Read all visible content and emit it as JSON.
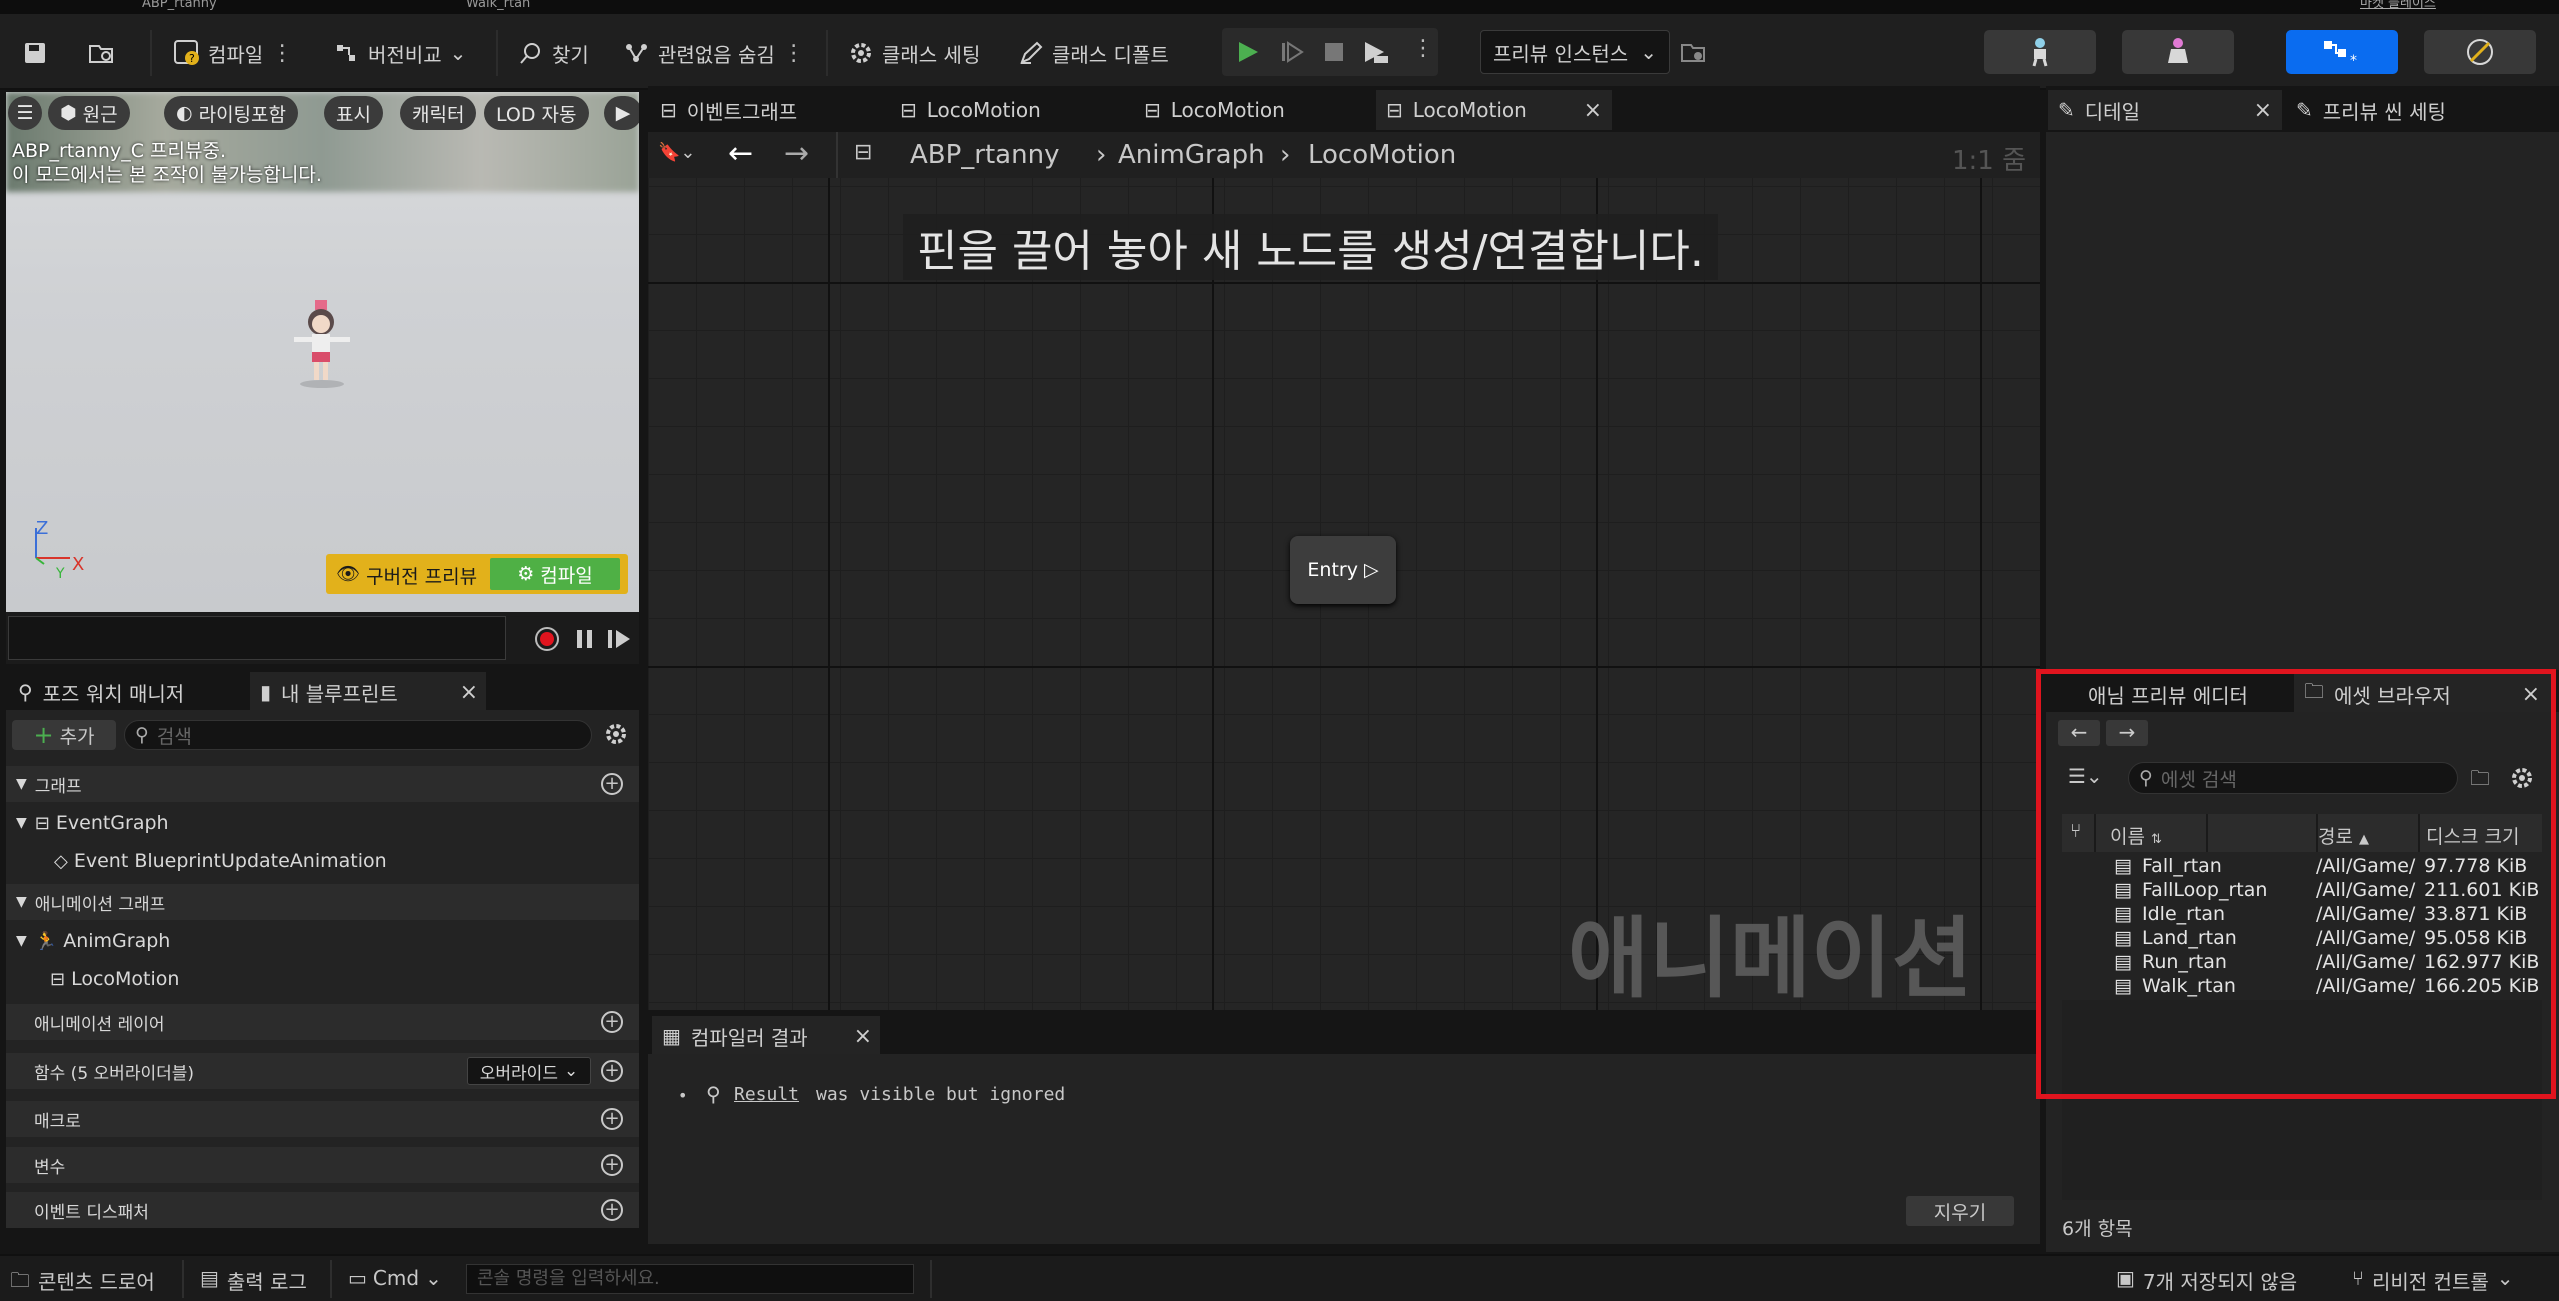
{
  "colors": {
    "accent_blue": "#0a6cf0",
    "play_green": "#4caf50",
    "highlight_red": "#e0141e",
    "compile_yellow": "#e2b11b"
  },
  "top_tabs": [
    "ABP_rtanny",
    "Walk_rtan"
  ],
  "top_right_text": "마켓 플레이스",
  "toolbar": {
    "compile": "컴파일",
    "diff": "버전비교",
    "find": "찾기",
    "hide_unrelated": "관련없음 숨김",
    "class_settings": "클래스 세팅",
    "class_defaults": "클래스 디폴트",
    "preview_instance": "프리뷰 인스턴스"
  },
  "viewport": {
    "chips": [
      "원근",
      "라이팅포함",
      "표시",
      "캐릭터",
      "LOD 자동"
    ],
    "note1": "ABP_rtanny_C 프리뷰중.",
    "note2": "이 모드에서는 본 조작이 불가능합니다.",
    "outdated": "구버전 프리뷰",
    "compile": "컴파일",
    "axis_z": "Z",
    "axis_x": "X",
    "axis_y": "Y"
  },
  "graph_tabs": [
    "이벤트그래프",
    "LocoMotion",
    "LocoMotion",
    "LocoMotion"
  ],
  "breadcrumb": {
    "root": "ABP_rtanny",
    "mid": "AnimGraph",
    "leaf": "LocoMotion",
    "zoom": "1:1 줌"
  },
  "graph": {
    "hint": "핀을 끌어 놓아 새 노드를 생성/연결합니다.",
    "entry": "Entry",
    "watermark": "애니메이션"
  },
  "compiler": {
    "tab": "컴파일러 결과",
    "result_word": "Result",
    "result_msg": "was visible but ignored",
    "clear": "지우기"
  },
  "left_tabs": {
    "pose_watch": "포즈 워치 매니저",
    "my_blueprint": "내 블루프린트"
  },
  "my_blueprint": {
    "add": "추가",
    "search_placeholder": "검색",
    "graphs": "그래프",
    "event_graph": "EventGraph",
    "event_node": "Event BlueprintUpdateAnimation",
    "anim_graphs": "애니메이션 그래프",
    "anim_graph": "AnimGraph",
    "loco": "LocoMotion",
    "anim_layers": "애니메이션 레이어",
    "functions": "함수 (5 오버라이더블)",
    "override": "오버라이드",
    "macros": "매크로",
    "variables": "변수",
    "dispatchers": "이벤트 디스패처"
  },
  "right_tabs": {
    "details": "디테일",
    "preview_scene": "프리뷰 씬 세팅"
  },
  "asset_tabs": {
    "anim_preview": "애님 프리뷰 에디터",
    "asset_browser": "에셋 브라우저"
  },
  "asset_browser": {
    "search_placeholder": "에셋 검색",
    "col_name": "이름",
    "col_path": "경로",
    "col_size": "디스크 크기",
    "rows": [
      {
        "name": "Fall_rtan",
        "path": "/All/Game/",
        "size": "97.778 KiB"
      },
      {
        "name": "FallLoop_rtan",
        "path": "/All/Game/",
        "size": "211.601 KiB"
      },
      {
        "name": "Idle_rtan",
        "path": "/All/Game/",
        "size": "33.871 KiB"
      },
      {
        "name": "Land_rtan",
        "path": "/All/Game/",
        "size": "95.058 KiB"
      },
      {
        "name": "Run_rtan",
        "path": "/All/Game/",
        "size": "162.977 KiB"
      },
      {
        "name": "Walk_rtan",
        "path": "/All/Game/",
        "size": "166.205 KiB"
      }
    ],
    "count": "6개 항목"
  },
  "statusbar": {
    "content_drawer": "콘텐츠 드로어",
    "output_log": "출력 로그",
    "cmd": "Cmd",
    "console_placeholder": "콘솔 명령을 입력하세요.",
    "unsaved": "7개 저장되지 않음",
    "revision": "리비전 컨트롤"
  }
}
